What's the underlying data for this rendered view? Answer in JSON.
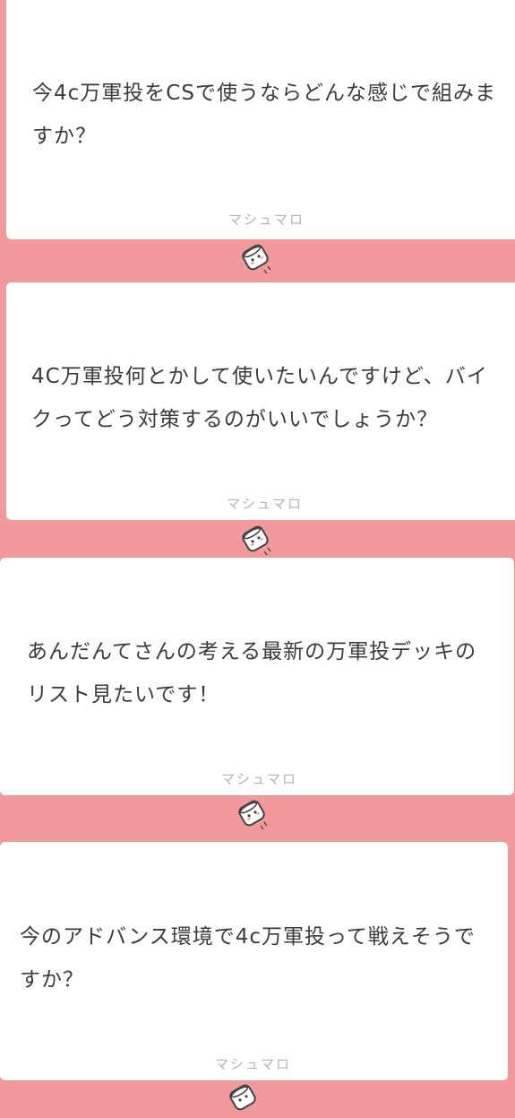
{
  "cards": [
    {
      "text": "今4c万軍投をCSで使うならどんな感じで組みま\nすか？",
      "brand": "マシュマロ"
    },
    {
      "text": "4C万軍投何とかして使いたいんですけど、バイ\nクってどう対策するのがいいでしょうか？",
      "brand": "マシュマロ"
    },
    {
      "text": "あんだんてさんの考える最新の万軍投デッキの\nリスト見たいです！",
      "brand": "マシュマロ"
    },
    {
      "text": "今のアドバンス環境で4c万軍投って戦えそうで\nすか？",
      "brand": "マシュマロ"
    }
  ],
  "logo_icon": "marshmallow-logo-icon",
  "colors": {
    "background": "#f2999c",
    "card": "#ffffff",
    "text": "#3b3b3b",
    "brand": "#b3b3b3"
  }
}
